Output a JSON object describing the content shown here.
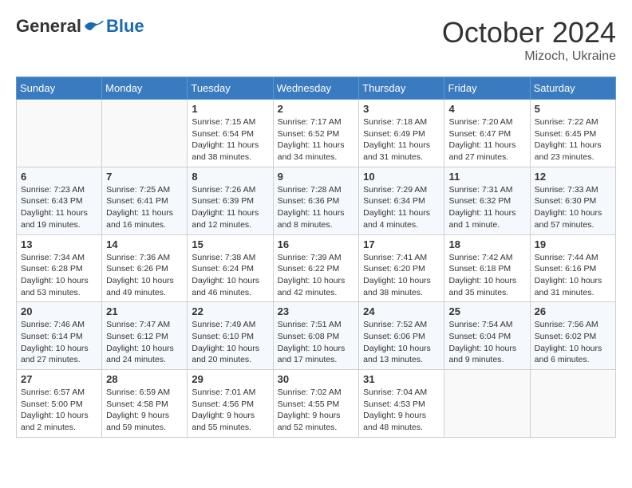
{
  "header": {
    "logo": {
      "general": "General",
      "blue": "Blue"
    },
    "title": "October 2024",
    "location": "Mizoch, Ukraine"
  },
  "weekdays": [
    "Sunday",
    "Monday",
    "Tuesday",
    "Wednesday",
    "Thursday",
    "Friday",
    "Saturday"
  ],
  "weeks": [
    {
      "row": 1,
      "days": [
        {
          "date": "",
          "sunrise": "",
          "sunset": "",
          "daylight": ""
        },
        {
          "date": "",
          "sunrise": "",
          "sunset": "",
          "daylight": ""
        },
        {
          "date": "1",
          "sunrise": "Sunrise: 7:15 AM",
          "sunset": "Sunset: 6:54 PM",
          "daylight": "Daylight: 11 hours and 38 minutes."
        },
        {
          "date": "2",
          "sunrise": "Sunrise: 7:17 AM",
          "sunset": "Sunset: 6:52 PM",
          "daylight": "Daylight: 11 hours and 34 minutes."
        },
        {
          "date": "3",
          "sunrise": "Sunrise: 7:18 AM",
          "sunset": "Sunset: 6:49 PM",
          "daylight": "Daylight: 11 hours and 31 minutes."
        },
        {
          "date": "4",
          "sunrise": "Sunrise: 7:20 AM",
          "sunset": "Sunset: 6:47 PM",
          "daylight": "Daylight: 11 hours and 27 minutes."
        },
        {
          "date": "5",
          "sunrise": "Sunrise: 7:22 AM",
          "sunset": "Sunset: 6:45 PM",
          "daylight": "Daylight: 11 hours and 23 minutes."
        }
      ]
    },
    {
      "row": 2,
      "days": [
        {
          "date": "6",
          "sunrise": "Sunrise: 7:23 AM",
          "sunset": "Sunset: 6:43 PM",
          "daylight": "Daylight: 11 hours and 19 minutes."
        },
        {
          "date": "7",
          "sunrise": "Sunrise: 7:25 AM",
          "sunset": "Sunset: 6:41 PM",
          "daylight": "Daylight: 11 hours and 16 minutes."
        },
        {
          "date": "8",
          "sunrise": "Sunrise: 7:26 AM",
          "sunset": "Sunset: 6:39 PM",
          "daylight": "Daylight: 11 hours and 12 minutes."
        },
        {
          "date": "9",
          "sunrise": "Sunrise: 7:28 AM",
          "sunset": "Sunset: 6:36 PM",
          "daylight": "Daylight: 11 hours and 8 minutes."
        },
        {
          "date": "10",
          "sunrise": "Sunrise: 7:29 AM",
          "sunset": "Sunset: 6:34 PM",
          "daylight": "Daylight: 11 hours and 4 minutes."
        },
        {
          "date": "11",
          "sunrise": "Sunrise: 7:31 AM",
          "sunset": "Sunset: 6:32 PM",
          "daylight": "Daylight: 11 hours and 1 minute."
        },
        {
          "date": "12",
          "sunrise": "Sunrise: 7:33 AM",
          "sunset": "Sunset: 6:30 PM",
          "daylight": "Daylight: 10 hours and 57 minutes."
        }
      ]
    },
    {
      "row": 3,
      "days": [
        {
          "date": "13",
          "sunrise": "Sunrise: 7:34 AM",
          "sunset": "Sunset: 6:28 PM",
          "daylight": "Daylight: 10 hours and 53 minutes."
        },
        {
          "date": "14",
          "sunrise": "Sunrise: 7:36 AM",
          "sunset": "Sunset: 6:26 PM",
          "daylight": "Daylight: 10 hours and 49 minutes."
        },
        {
          "date": "15",
          "sunrise": "Sunrise: 7:38 AM",
          "sunset": "Sunset: 6:24 PM",
          "daylight": "Daylight: 10 hours and 46 minutes."
        },
        {
          "date": "16",
          "sunrise": "Sunrise: 7:39 AM",
          "sunset": "Sunset: 6:22 PM",
          "daylight": "Daylight: 10 hours and 42 minutes."
        },
        {
          "date": "17",
          "sunrise": "Sunrise: 7:41 AM",
          "sunset": "Sunset: 6:20 PM",
          "daylight": "Daylight: 10 hours and 38 minutes."
        },
        {
          "date": "18",
          "sunrise": "Sunrise: 7:42 AM",
          "sunset": "Sunset: 6:18 PM",
          "daylight": "Daylight: 10 hours and 35 minutes."
        },
        {
          "date": "19",
          "sunrise": "Sunrise: 7:44 AM",
          "sunset": "Sunset: 6:16 PM",
          "daylight": "Daylight: 10 hours and 31 minutes."
        }
      ]
    },
    {
      "row": 4,
      "days": [
        {
          "date": "20",
          "sunrise": "Sunrise: 7:46 AM",
          "sunset": "Sunset: 6:14 PM",
          "daylight": "Daylight: 10 hours and 27 minutes."
        },
        {
          "date": "21",
          "sunrise": "Sunrise: 7:47 AM",
          "sunset": "Sunset: 6:12 PM",
          "daylight": "Daylight: 10 hours and 24 minutes."
        },
        {
          "date": "22",
          "sunrise": "Sunrise: 7:49 AM",
          "sunset": "Sunset: 6:10 PM",
          "daylight": "Daylight: 10 hours and 20 minutes."
        },
        {
          "date": "23",
          "sunrise": "Sunrise: 7:51 AM",
          "sunset": "Sunset: 6:08 PM",
          "daylight": "Daylight: 10 hours and 17 minutes."
        },
        {
          "date": "24",
          "sunrise": "Sunrise: 7:52 AM",
          "sunset": "Sunset: 6:06 PM",
          "daylight": "Daylight: 10 hours and 13 minutes."
        },
        {
          "date": "25",
          "sunrise": "Sunrise: 7:54 AM",
          "sunset": "Sunset: 6:04 PM",
          "daylight": "Daylight: 10 hours and 9 minutes."
        },
        {
          "date": "26",
          "sunrise": "Sunrise: 7:56 AM",
          "sunset": "Sunset: 6:02 PM",
          "daylight": "Daylight: 10 hours and 6 minutes."
        }
      ]
    },
    {
      "row": 5,
      "days": [
        {
          "date": "27",
          "sunrise": "Sunrise: 6:57 AM",
          "sunset": "Sunset: 5:00 PM",
          "daylight": "Daylight: 10 hours and 2 minutes."
        },
        {
          "date": "28",
          "sunrise": "Sunrise: 6:59 AM",
          "sunset": "Sunset: 4:58 PM",
          "daylight": "Daylight: 9 hours and 59 minutes."
        },
        {
          "date": "29",
          "sunrise": "Sunrise: 7:01 AM",
          "sunset": "Sunset: 4:56 PM",
          "daylight": "Daylight: 9 hours and 55 minutes."
        },
        {
          "date": "30",
          "sunrise": "Sunrise: 7:02 AM",
          "sunset": "Sunset: 4:55 PM",
          "daylight": "Daylight: 9 hours and 52 minutes."
        },
        {
          "date": "31",
          "sunrise": "Sunrise: 7:04 AM",
          "sunset": "Sunset: 4:53 PM",
          "daylight": "Daylight: 9 hours and 48 minutes."
        },
        {
          "date": "",
          "sunrise": "",
          "sunset": "",
          "daylight": ""
        },
        {
          "date": "",
          "sunrise": "",
          "sunset": "",
          "daylight": ""
        }
      ]
    }
  ]
}
